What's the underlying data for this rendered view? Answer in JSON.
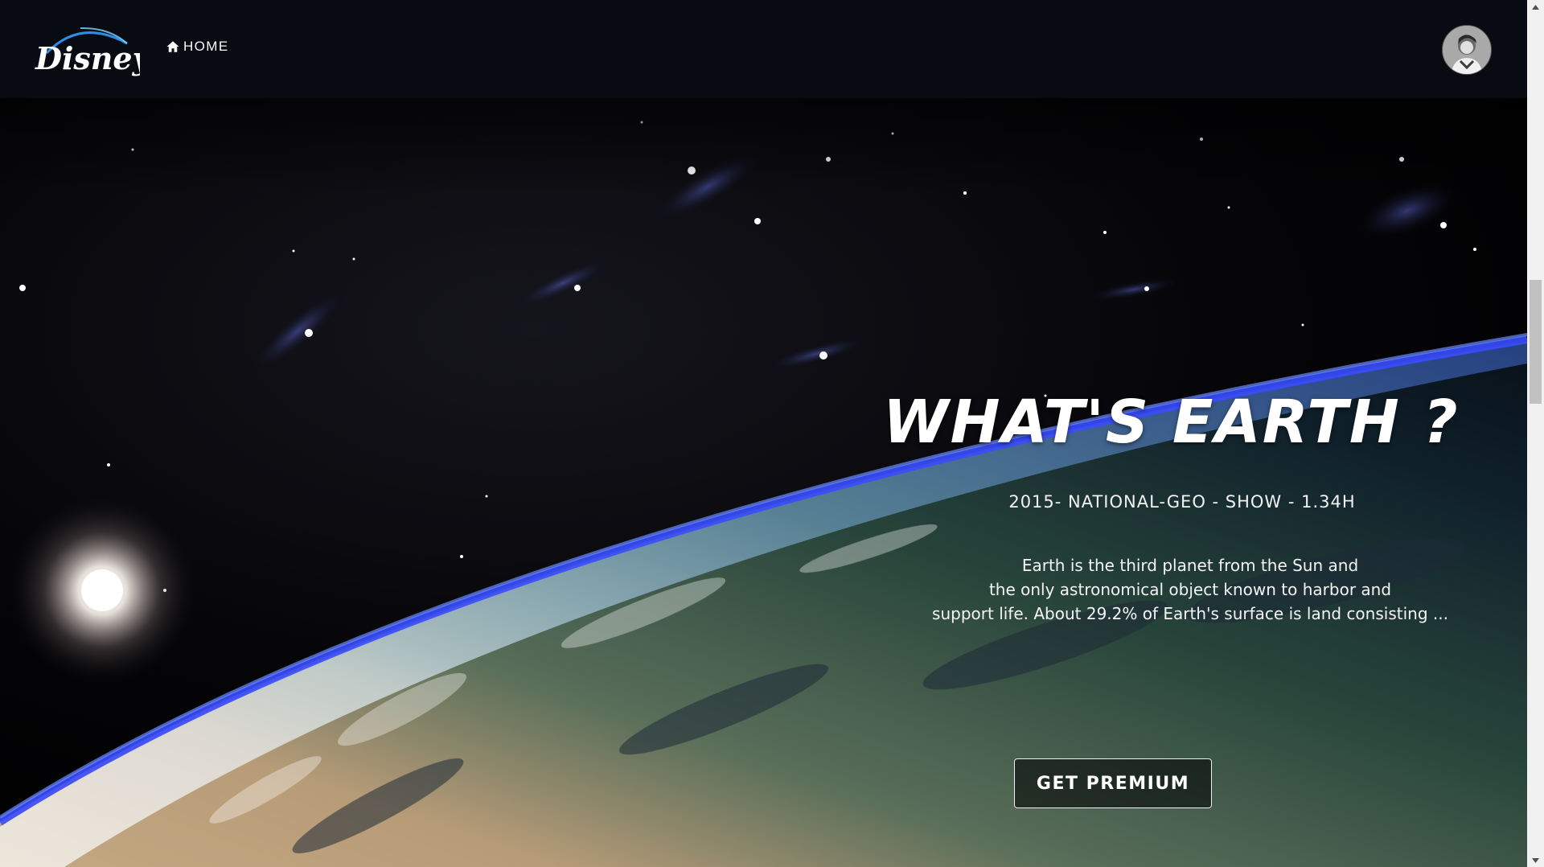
{
  "app": {
    "logo_text": "Disney+",
    "brand_color": "#090b13"
  },
  "nav": {
    "home_label": "HOME",
    "home_icon": "home-icon"
  },
  "user": {
    "avatar_icon": "user-avatar"
  },
  "hero": {
    "title": "WHAT'S EARTH ?",
    "meta": "2015- NATIONAL-GEO - SHOW - 1.34H",
    "description_lines": [
      "Earth is the third planet from the Sun and",
      "the only astronomical object known to harbor and",
      "support life. About 29.2% of Earth's surface is land consisting ..."
    ],
    "cta_label": "GET PREMIUM"
  }
}
